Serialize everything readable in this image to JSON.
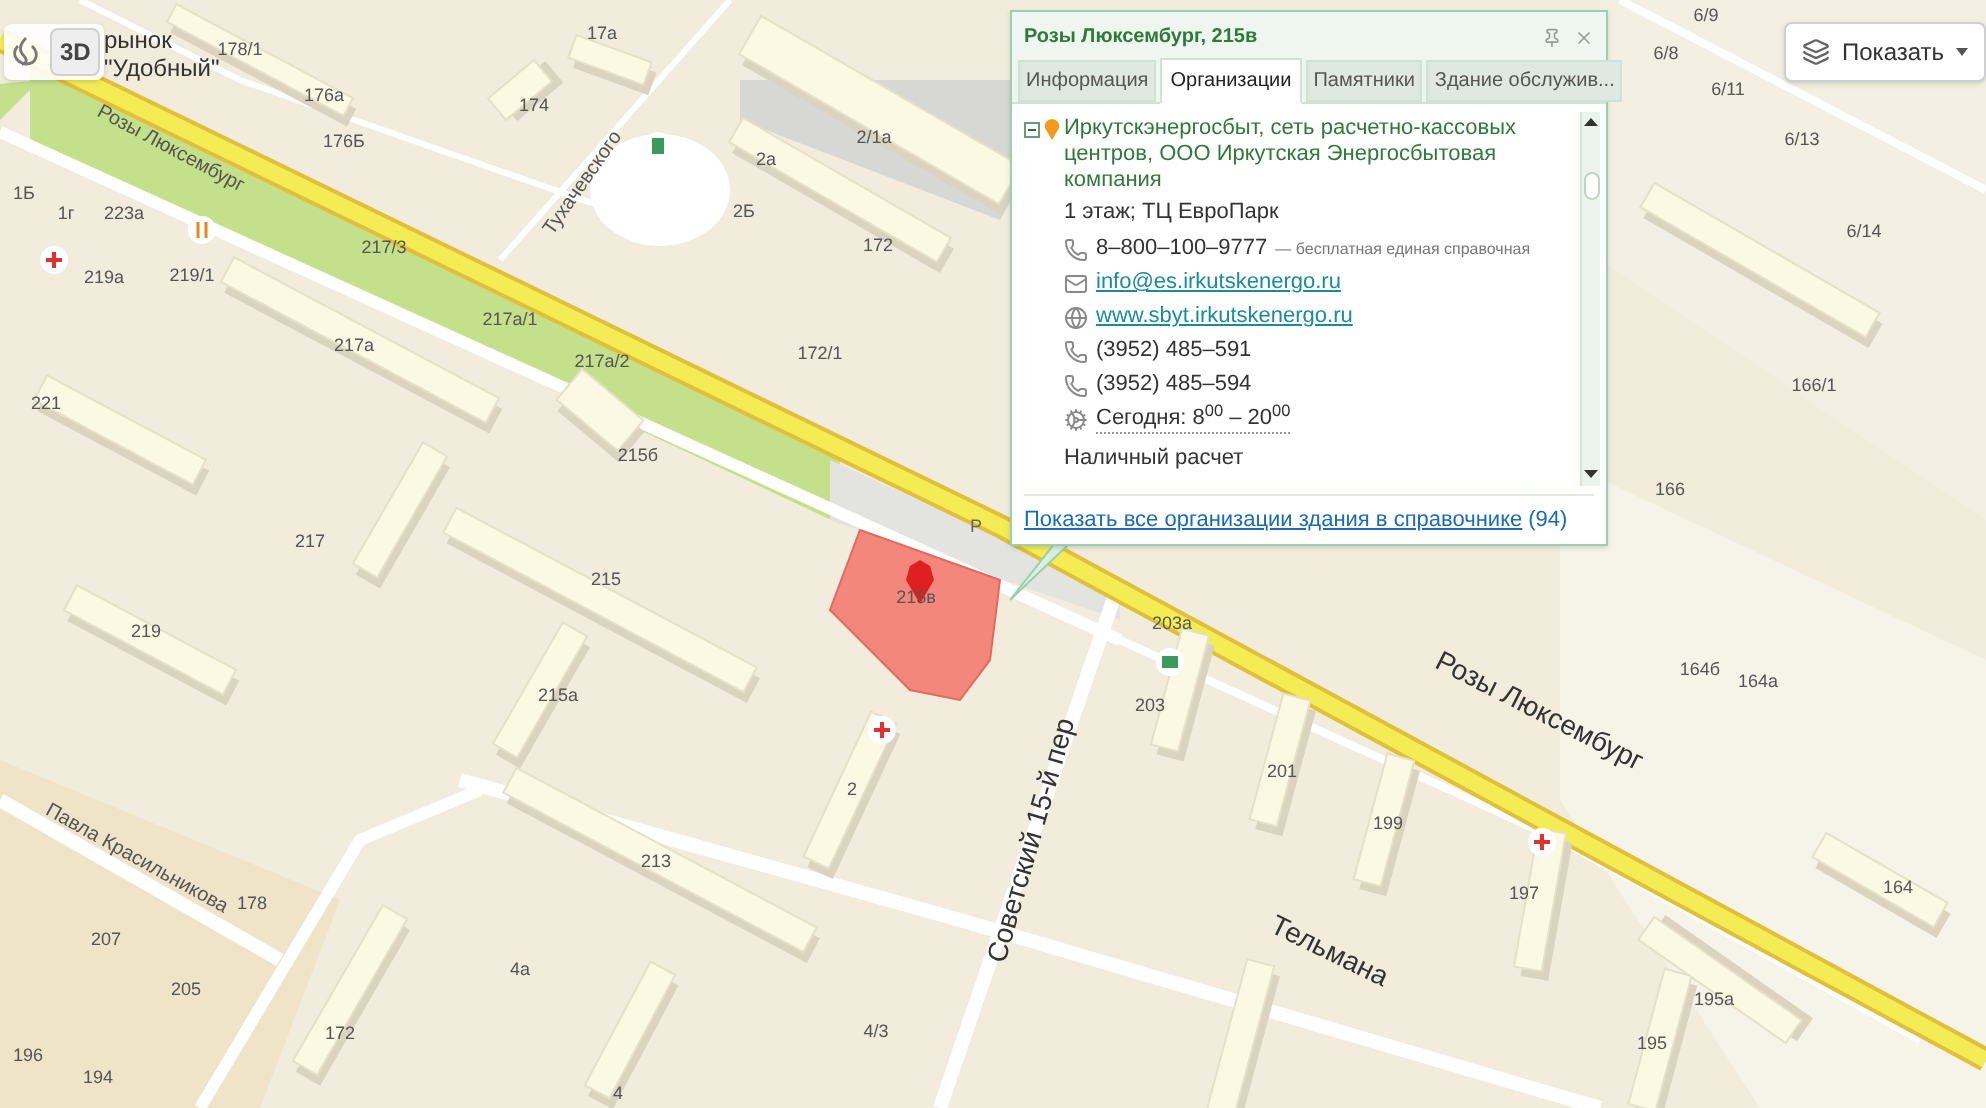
{
  "map_controls": {
    "view_button": "3D",
    "layers_button": "Показать"
  },
  "map": {
    "place_label": [
      "рынок",
      "\"Удобный\""
    ],
    "house_numbers": [
      "178/1",
      "176а",
      "176Б",
      "17а",
      "174",
      "2/1а",
      "2а",
      "2Б",
      "172",
      "1Б",
      "1г",
      "223а",
      "219а",
      "219/1",
      "217/3",
      "217а/1",
      "217а/2",
      "217а",
      "172/1",
      "221",
      "215б",
      "217",
      "215",
      "215в",
      "219",
      "215а",
      "2",
      "213",
      "178",
      "207",
      "205",
      "196",
      "194",
      "172",
      "4а",
      "4/3",
      "4",
      "203а",
      "203",
      "201",
      "199",
      "197",
      "195а",
      "195",
      "164б",
      "164а",
      "164",
      "166",
      "166/1",
      "6/8",
      "6/9",
      "6/11",
      "6/13",
      "6/14"
    ],
    "street_labels": [
      "Розы Люксембург",
      "Тухачевского",
      "Розы Люксембург",
      "Советский 15-й пер",
      "Тельмана",
      "Павла Красильникова"
    ],
    "parking_label": "Р"
  },
  "popup": {
    "title": "Розы Люксембург, 215в",
    "tabs": [
      {
        "label": "Информация",
        "selected": false
      },
      {
        "label": "Организации",
        "selected": true
      },
      {
        "label": "Памятники",
        "selected": false
      },
      {
        "label": "Здание обслужив...",
        "selected": false
      }
    ],
    "organization": {
      "expanded": true,
      "name": "Иркутскэнергосбыт, сеть расчетно-кассовых центров, ООО Иркутская Энергосбытовая компания",
      "location": "1 этаж; ТЦ ЕвроПарк",
      "contacts": [
        {
          "kind": "phone",
          "text": "8–800–100–9777",
          "note": "— бесплатная единая справочная"
        },
        {
          "kind": "email",
          "text": "info@es.irkutskenergo.ru"
        },
        {
          "kind": "web",
          "text": "www.sbyt.irkutskenergo.ru"
        },
        {
          "kind": "phone",
          "text": "(3952) 485–591"
        },
        {
          "kind": "phone",
          "text": "(3952) 485–594"
        },
        {
          "kind": "hours",
          "text": "Сегодня: 8$^{00}$ – 20$^{00}$"
        }
      ],
      "payment": "Наличный расчет"
    },
    "footer_link": "Показать все организации здания в справочнике",
    "footer_count": "(94)"
  }
}
